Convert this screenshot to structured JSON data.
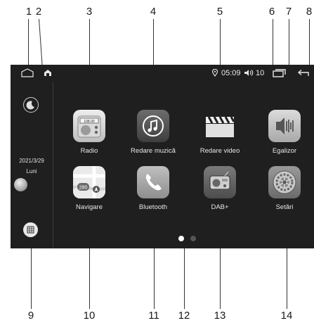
{
  "callouts": [
    "1",
    "2",
    "3",
    "4",
    "5",
    "6",
    "7",
    "8",
    "9",
    "10",
    "11",
    "12",
    "13",
    "14"
  ],
  "status": {
    "time": "05:09",
    "volume": "10"
  },
  "sidebar": {
    "date": "2021/3/29",
    "day": "Luni"
  },
  "apps": [
    {
      "label": "Radio",
      "icon": "radio-icon"
    },
    {
      "label": "Redare muzică",
      "icon": "music-note-icon"
    },
    {
      "label": "Redare video",
      "icon": "clapperboard-icon"
    },
    {
      "label": "Egalizor",
      "icon": "equalizer-speaker-icon"
    },
    {
      "label": "Navigare",
      "icon": "map-icon"
    },
    {
      "label": "Bluetooth",
      "icon": "phone-icon"
    },
    {
      "label": "DAB+",
      "icon": "dab-radio-icon"
    },
    {
      "label": "Setări",
      "icon": "gear-icon"
    }
  ],
  "radio_icon_text": "108.00",
  "navigation_icon_text": "280",
  "pager": {
    "pages": 2,
    "active": 1
  },
  "colors": {
    "screen": "#1f1f1f",
    "active_dot": "#ffffff",
    "inactive_dot": "#555555"
  }
}
